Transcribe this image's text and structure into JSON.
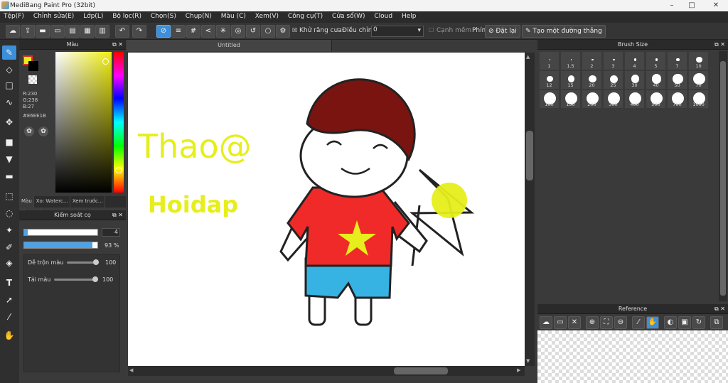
{
  "window": {
    "title": "MediBang Paint Pro (32bit)",
    "controls": [
      "–",
      "□",
      "✕"
    ]
  },
  "menu": [
    "Tệp(F)",
    "Chỉnh sửa(E)",
    "Lớp(L)",
    "Bộ lọc(R)",
    "Chọn(S)",
    "Chụp(N)",
    "Màu (C)",
    "Xem(V)",
    "Công cụ(T)",
    "Cửa sổ(W)",
    "Cloud",
    "Help"
  ],
  "toolbar": {
    "antialias_label": "Khử răng cưa",
    "correction_label": "Điều chỉnh",
    "correction_value": "0",
    "edge_label": "Cạnh mềm",
    "keys_label": "Phím",
    "reset_label": "Đặt lại",
    "line_label": "Tạo một đường thẳng"
  },
  "color_panel": {
    "title": "Màu",
    "r": "R:230",
    "g": "G:238",
    "b": "B:27",
    "hex": "#E6EE1B",
    "tabs": [
      "Màu",
      "Xo: Waterc…",
      "Xem trước…",
      "lăng …"
    ]
  },
  "brush_control": {
    "title": "Kiểm soát cọ",
    "size_value": "4",
    "opacity_value": "93 %",
    "blend_label": "Dễ trộn màu",
    "blend_value": "100",
    "ink_label": "Tải màu",
    "ink_value": "100"
  },
  "canvas": {
    "tab": "Untitled",
    "text1": "Thao@",
    "text2": "Hoidap"
  },
  "brush_size": {
    "title": "Brush Size",
    "sizes": [
      "1",
      "1.5",
      "2",
      "3",
      "4",
      "5",
      "7",
      "10",
      "12",
      "15",
      "20",
      "25",
      "30",
      "40",
      "50",
      "70",
      "100",
      "150",
      "200",
      "300",
      "400",
      "500",
      "700",
      "1000"
    ]
  },
  "reference": {
    "title": "Reference"
  },
  "colors": {
    "accent": "#3b8fdb",
    "foreground": "#e6ee1b"
  }
}
